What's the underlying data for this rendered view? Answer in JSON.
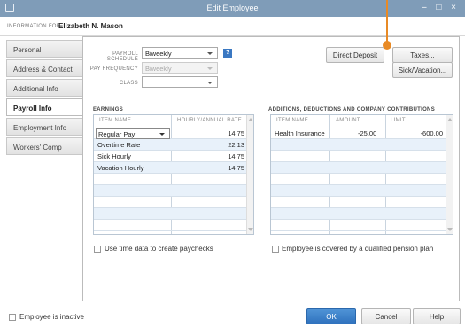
{
  "window": {
    "title": "Edit Employee",
    "controls": "– □ ×"
  },
  "info": {
    "label": "INFORMATION FOR",
    "name": "Elizabeth N. Mason"
  },
  "tabs": [
    {
      "label": "Personal"
    },
    {
      "label": "Address & Contact"
    },
    {
      "label": "Additional Info"
    },
    {
      "label": "Payroll Info",
      "active": true
    },
    {
      "label": "Employment Info"
    },
    {
      "label": "Workers' Comp"
    }
  ],
  "payroll": {
    "schedule_label": "PAYROLL SCHEDULE",
    "schedule_value": "Biweekly",
    "frequency_label": "PAY FREQUENCY",
    "frequency_value": "Biweekly",
    "class_label": "CLASS",
    "class_value": "",
    "help_icon": "?"
  },
  "buttons": {
    "direct_deposit": "Direct Deposit",
    "taxes": "Taxes...",
    "sick_vacation": "Sick/Vacation...",
    "ok": "OK",
    "cancel": "Cancel",
    "help": "Help"
  },
  "earnings": {
    "title": "EARNINGS",
    "col_item": "ITEM NAME",
    "col_rate": "HOURLY/ANNUAL RATE",
    "rows": [
      {
        "item": "Regular Pay",
        "rate": "14.75"
      },
      {
        "item": "Overtime Rate",
        "rate": "22.13"
      },
      {
        "item": "Sick Hourly",
        "rate": "14.75"
      },
      {
        "item": "Vacation Hourly",
        "rate": "14.75"
      }
    ]
  },
  "additions": {
    "title": "ADDITIONS, DEDUCTIONS AND COMPANY CONTRIBUTIONS",
    "col_item": "ITEM NAME",
    "col_amount": "AMOUNT",
    "col_limit": "LIMIT",
    "rows": [
      {
        "item": "Health Insurance",
        "amount": "-25.00",
        "limit": "-600.00"
      }
    ]
  },
  "checkboxes": {
    "time_data": "Use time data to create paychecks",
    "pension": "Employee is covered by a qualified pension plan",
    "inactive": "Employee is inactive"
  },
  "accent": "#e88a25"
}
